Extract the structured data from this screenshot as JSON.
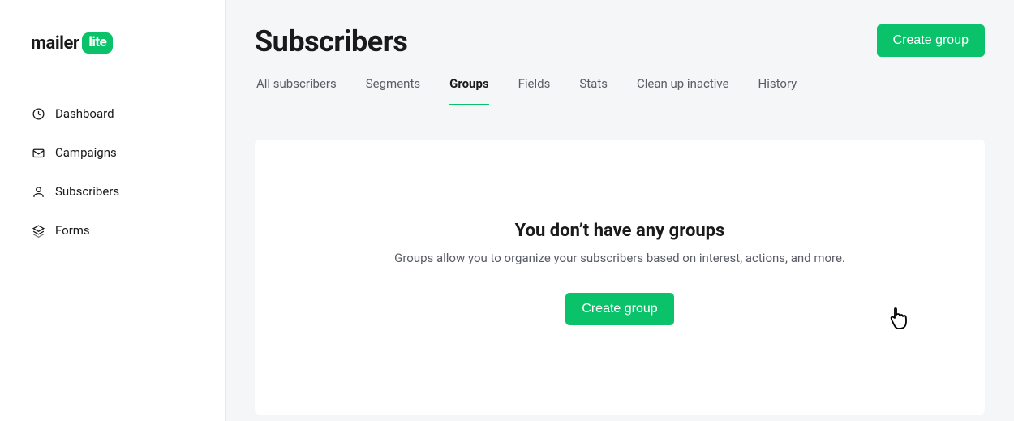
{
  "logo": {
    "text1": "mailer",
    "text2": "lite"
  },
  "sidebar": {
    "items": [
      {
        "label": "Dashboard"
      },
      {
        "label": "Campaigns"
      },
      {
        "label": "Subscribers"
      },
      {
        "label": "Forms"
      }
    ]
  },
  "header": {
    "title": "Subscribers",
    "primary_button": "Create group"
  },
  "tabs": [
    {
      "label": "All subscribers",
      "active": false
    },
    {
      "label": "Segments",
      "active": false
    },
    {
      "label": "Groups",
      "active": true
    },
    {
      "label": "Fields",
      "active": false
    },
    {
      "label": "Stats",
      "active": false
    },
    {
      "label": "Clean up inactive",
      "active": false
    },
    {
      "label": "History",
      "active": false
    }
  ],
  "empty_state": {
    "title": "You don’t have any groups",
    "description": "Groups allow you to organize your subscribers based on interest, actions, and more.",
    "button": "Create group"
  }
}
